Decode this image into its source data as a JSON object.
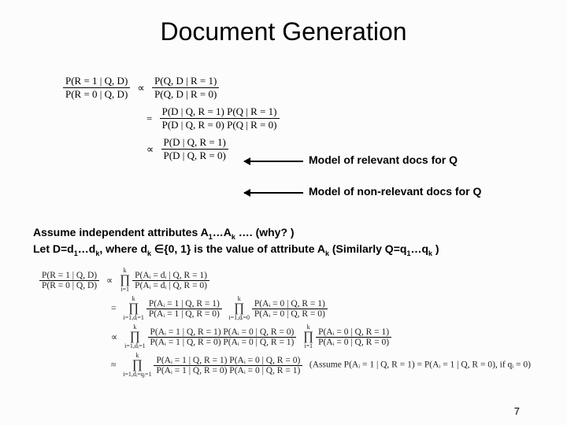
{
  "title": "Document Generation",
  "eq1": {
    "lhs_num": "P(R = 1 | Q, D)",
    "lhs_den": "P(R = 0 | Q, D)",
    "prop": "∝",
    "rhs1_num": "P(Q, D | R = 1)",
    "rhs1_den": "P(Q, D | R = 0)",
    "eq": "=",
    "rhs2_num": "P(D | Q, R = 1) P(Q | R = 1)",
    "rhs2_den": "P(D | Q, R = 0) P(Q | R = 0)",
    "rhs3_num": "P(D | Q, R = 1)",
    "rhs3_den": "P(D | Q, R = 0)"
  },
  "anno1": "Model of relevant docs for Q",
  "anno2": "Model of non-relevant docs for Q",
  "assume_line1_a": "Assume independent attributes A",
  "assume_line1_b": "…A",
  "assume_line1_c": " …. (why? )",
  "assume_line2_a": "Let D=d",
  "assume_line2_b": "…d",
  "assume_line2_c": ", where d",
  "assume_line2_d": " ∈{0, 1} is the value of attribute A",
  "assume_line2_e": " (Similarly Q=q",
  "assume_line2_f": "…q",
  "assume_line2_g": " )",
  "eq2": {
    "lhs_num": "P(R = 1 | Q, D)",
    "lhs_den": "P(R = 0 | Q, D)",
    "prop": "∝",
    "eq": "=",
    "approx": "≈",
    "prod_top": "k",
    "prod_bot1": "i=1",
    "prod_bot2": "i=1,dᵢ=1",
    "prod_bot3": "i=1,dᵢ=0",
    "prod_bot4": "i=1,dᵢ=qᵢ=1",
    "r1_num": "P(Aᵢ = dᵢ | Q, R = 1)",
    "r1_den": "P(Aᵢ = dᵢ | Q, R = 0)",
    "r2a_num": "P(Aᵢ = 1 | Q, R = 1)",
    "r2a_den": "P(Aᵢ = 1 | Q, R = 0)",
    "r2b_num": "P(Aᵢ = 0 | Q, R = 1)",
    "r2b_den": "P(Aᵢ = 0 | Q, R = 0)",
    "r3a_num": "P(Aᵢ = 1 | Q, R = 1) P(Aᵢ = 0 | Q, R = 0)",
    "r3a_den": "P(Aᵢ = 1 | Q, R = 0) P(Aᵢ = 0 | Q, R = 1)",
    "r3b_num": "P(Aᵢ = 0 | Q, R = 1)",
    "r3b_den": "P(Aᵢ = 0 | Q, R = 0)",
    "r4_num": "P(Aᵢ = 1 | Q, R = 1) P(Aᵢ = 0 | Q, R = 0)",
    "r4_den": "P(Aᵢ = 1 | Q, R = 0) P(Aᵢ = 0 | Q, R = 1)",
    "aside": "(Assume  P(Aᵢ = 1 | Q, R = 1) = P(Aᵢ = 1 | Q, R = 0), if  qᵢ = 0)"
  },
  "page": "7"
}
